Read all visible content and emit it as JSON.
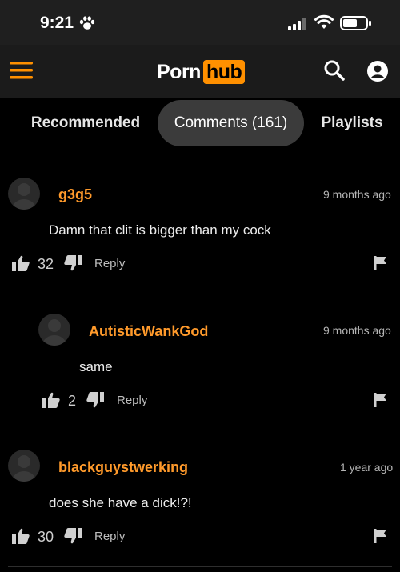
{
  "status_bar": {
    "time": "9:21"
  },
  "header": {
    "logo_left": "Porn",
    "logo_right": "hub",
    "icons": [
      "menu-icon",
      "search-icon",
      "user-icon"
    ]
  },
  "tabs": [
    {
      "label": "Recommended",
      "active": false
    },
    {
      "label": "Comments (161)",
      "active": true
    },
    {
      "label": "Playlists",
      "active": false
    }
  ],
  "comments": [
    {
      "username": "g3g5",
      "time": "9 months ago",
      "text": "Damn that clit is bigger than my cock",
      "likes": "32",
      "reply_label": "Reply",
      "is_reply": false
    },
    {
      "username": "AutisticWankGod",
      "time": "9 months ago",
      "text": "same",
      "likes": "2",
      "reply_label": "Reply",
      "is_reply": true
    },
    {
      "username": "blackguystwerking",
      "time": "1 year ago",
      "text": "does she have a dick!?!",
      "likes": "30",
      "reply_label": "Reply",
      "is_reply": false
    }
  ],
  "colors": {
    "accent": "#ff9000",
    "username": "#ff9a2b",
    "background": "#000000",
    "active_tab": "#3b3b3b"
  }
}
